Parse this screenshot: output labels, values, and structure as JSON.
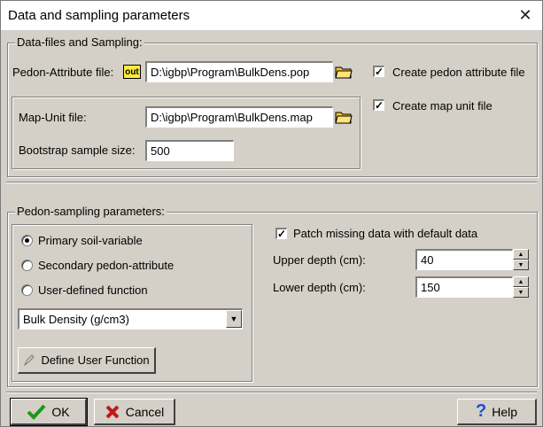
{
  "window": {
    "title": "Data and sampling parameters",
    "close_glyph": "✕"
  },
  "datafiles": {
    "legend": "Data-files and Sampling:",
    "pedon_label": "Pedon-Attribute file:",
    "pedon_badge": "out",
    "pedon_value": "D:\\igbp\\Program\\BulkDens.pop",
    "create_pedon_label": "Create pedon attribute file",
    "create_pedon_checked": true,
    "map_label": "Map-Unit file:",
    "map_value": "D:\\igbp\\Program\\BulkDens.map",
    "create_map_label": "Create map unit file",
    "create_map_checked": true,
    "bootstrap_label": "Bootstrap sample size:",
    "bootstrap_value": "500"
  },
  "sampling": {
    "legend": "Pedon-sampling parameters:",
    "radio_primary": "Primary soil-variable",
    "radio_secondary": "Secondary pedon-attribute",
    "radio_user": "User-defined function",
    "selected_radio": "primary",
    "combo_value": "Bulk Density (g/cm3)",
    "define_button": "Define User Function",
    "patch_label": "Patch missing data with default data",
    "patch_checked": true,
    "upper_label": "Upper depth (cm):",
    "upper_value": "40",
    "lower_label": "Lower depth (cm):",
    "lower_value": "150"
  },
  "footer": {
    "ok": "OK",
    "cancel": "Cancel",
    "help": "Help"
  },
  "colors": {
    "ok_check": "#1a9a1a",
    "cancel_x": "#c01818",
    "help_q": "#1a4fd0",
    "badge": "#ffeb3b"
  }
}
